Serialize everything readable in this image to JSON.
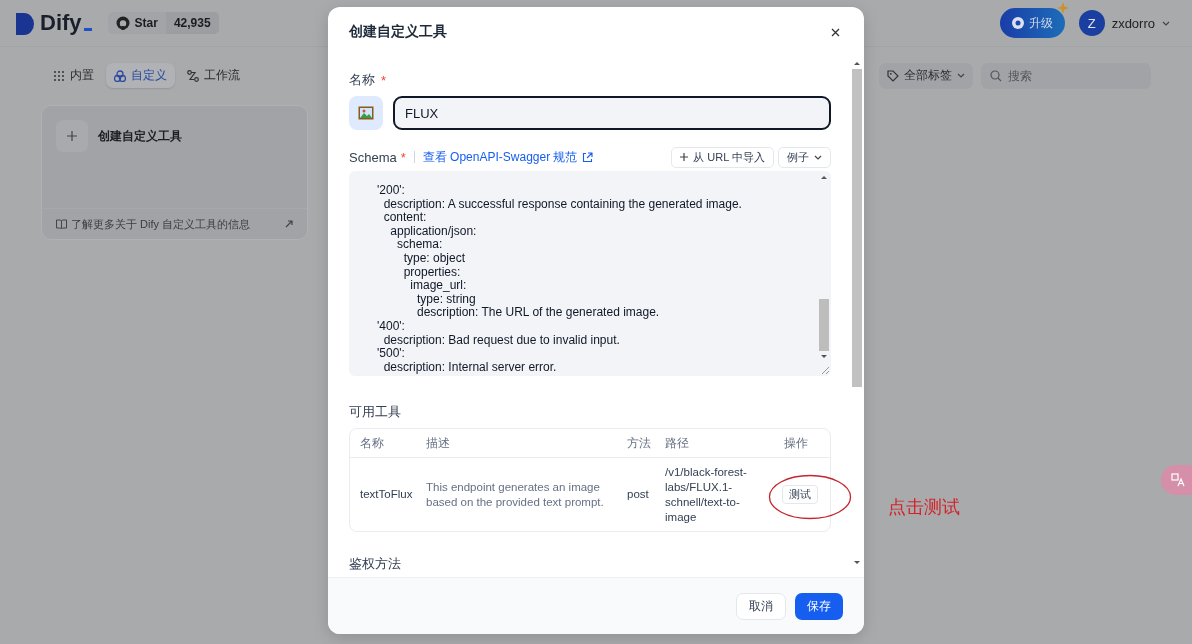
{
  "header": {
    "logo_text": "Dify",
    "github": {
      "label": "Star",
      "count": "42,935"
    },
    "upgrade": "升级",
    "user": {
      "avatar": "Z",
      "name": "zxdorro"
    }
  },
  "tabs": [
    {
      "label": "内置",
      "selected": false
    },
    {
      "label": "自定义",
      "selected": true
    },
    {
      "label": "工作流",
      "selected": false
    }
  ],
  "filters": {
    "tag": "全部标签",
    "search": {
      "placeholder": "搜索"
    }
  },
  "create_card": {
    "title": "创建自定义工具",
    "footer": "了解更多关于 Dify 自定义工具的信息"
  },
  "modal": {
    "title": "创建自定义工具",
    "name_field": {
      "label": "名称",
      "required_mark": "*",
      "value": "FLUX"
    },
    "schema": {
      "label": "Schema",
      "required_mark": "*",
      "link": "查看 OpenAPI-Swagger 规范",
      "import_button": "从 URL 中导入",
      "example_button": "例子",
      "code_lines": [
        "'200':",
        "  description: A successful response containing the generated image.",
        "  content:",
        "    application/json:",
        "      schema:",
        "        type: object",
        "        properties:",
        "          image_url:",
        "            type: string",
        "            description: The URL of the generated image.",
        "'400':",
        "  description: Bad request due to invalid input.",
        "'500':",
        "  description: Internal server error."
      ]
    },
    "tools": {
      "heading": "可用工具",
      "columns": [
        "名称",
        "描述",
        "方法",
        "路径",
        "操作"
      ],
      "rows": [
        {
          "name": "textToFlux",
          "description": "This endpoint generates an image based on the provided text prompt.",
          "method": "post",
          "path": "/v1/black-forest-labs/FLUX.1-schnell/text-to-image",
          "action": "测试"
        }
      ]
    },
    "auth": {
      "heading": "鉴权方法"
    },
    "buttons": {
      "cancel": "取消",
      "save": "保存"
    }
  },
  "annotation": {
    "text": "点击测试"
  }
}
